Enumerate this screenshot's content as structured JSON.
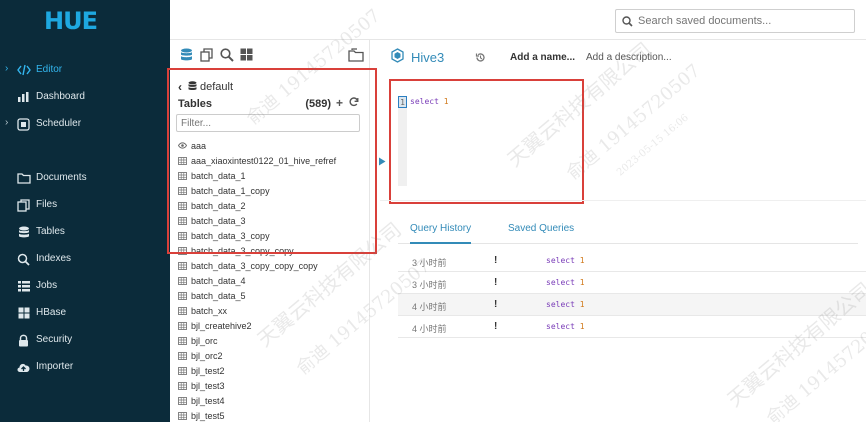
{
  "app": {
    "logo_text": "HUE"
  },
  "nav": {
    "items": [
      {
        "label": "Editor",
        "icon": "code-icon",
        "has_chevron": true,
        "active": true
      },
      {
        "label": "Dashboard",
        "icon": "bar-chart-icon",
        "has_chevron": false,
        "active": false
      },
      {
        "label": "Scheduler",
        "icon": "scheduler-icon",
        "has_chevron": true,
        "active": false
      },
      {
        "label": "Documents",
        "icon": "folder-icon",
        "has_chevron": false,
        "active": false
      },
      {
        "label": "Files",
        "icon": "files-icon",
        "has_chevron": false,
        "active": false
      },
      {
        "label": "Tables",
        "icon": "database-icon",
        "has_chevron": false,
        "active": false
      },
      {
        "label": "Indexes",
        "icon": "search-icon",
        "has_chevron": false,
        "active": false
      },
      {
        "label": "Jobs",
        "icon": "list-icon",
        "has_chevron": false,
        "active": false
      },
      {
        "label": "HBase",
        "icon": "grid-icon",
        "has_chevron": false,
        "active": false
      },
      {
        "label": "Security",
        "icon": "lock-icon",
        "has_chevron": false,
        "active": false
      },
      {
        "label": "Importer",
        "icon": "cloud-upload-icon",
        "has_chevron": false,
        "active": false
      }
    ]
  },
  "topbar": {
    "search_placeholder": "Search saved documents..."
  },
  "assist": {
    "database": "default",
    "tables_label": "Tables",
    "tables_count": "(589)",
    "filter_placeholder": "Filter...",
    "tables": [
      {
        "name": "aaa",
        "type": "view"
      },
      {
        "name": "aaa_xiaoxintest0122_01_hive_refref",
        "type": "table"
      },
      {
        "name": "batch_data_1",
        "type": "table"
      },
      {
        "name": "batch_data_1_copy",
        "type": "table"
      },
      {
        "name": "batch_data_2",
        "type": "table"
      },
      {
        "name": "batch_data_3",
        "type": "table"
      },
      {
        "name": "batch_data_3_copy",
        "type": "table"
      },
      {
        "name": "batch_data_3_copy_copy",
        "type": "table"
      },
      {
        "name": "batch_data_3_copy_copy_copy",
        "type": "table"
      },
      {
        "name": "batch_data_4",
        "type": "table"
      },
      {
        "name": "batch_data_5",
        "type": "table"
      },
      {
        "name": "batch_xx",
        "type": "table"
      },
      {
        "name": "bjl_createhive2",
        "type": "table"
      },
      {
        "name": "bjl_orc",
        "type": "table"
      },
      {
        "name": "bjl_orc2",
        "type": "table"
      },
      {
        "name": "bjl_test2",
        "type": "table"
      },
      {
        "name": "bjl_test3",
        "type": "table"
      },
      {
        "name": "bjl_test4",
        "type": "table"
      },
      {
        "name": "bjl_test5",
        "type": "table"
      }
    ]
  },
  "editor": {
    "tab_label": "Hive3",
    "name_placeholder": "Add a name...",
    "description_placeholder": "Add a description...",
    "line_number": "1",
    "code_keyword": "select",
    "code_value": "1"
  },
  "query_tabs": {
    "history_label": "Query History",
    "saved_label": "Saved Queries"
  },
  "history": [
    {
      "time": "3 小时前",
      "flag": "!",
      "keyword": "select",
      "value": "1"
    },
    {
      "time": "3 小时前",
      "flag": "!",
      "keyword": "select",
      "value": "1"
    },
    {
      "time": "4 小时前",
      "flag": "!",
      "keyword": "select",
      "value": "1"
    },
    {
      "time": "4 小时前",
      "flag": "!",
      "keyword": "select",
      "value": "1"
    }
  ],
  "watermark": {
    "line1": "天翼云科技有限公司",
    "line2": "俞迪 19145720507",
    "line3": "2023-05-15 16:06"
  },
  "colors": {
    "nav_bg": "#0b2b3a",
    "accent": "#338bb8",
    "highlight_red": "#d9403a",
    "sql_keyword": "#7a3db8",
    "sql_number": "#d17a1c"
  }
}
